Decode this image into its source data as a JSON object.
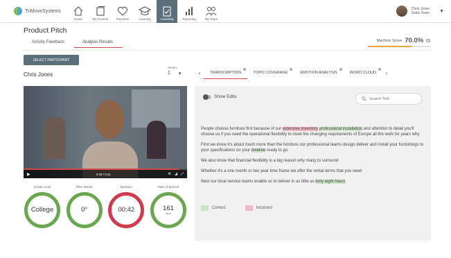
{
  "brand": {
    "name": "TriMoveSystems"
  },
  "nav": [
    {
      "label": "Home",
      "icon": "home-icon",
      "active": false
    },
    {
      "label": "My Content",
      "icon": "content-icon",
      "active": false
    },
    {
      "label": "Favorites",
      "icon": "heart-icon",
      "active": false
    },
    {
      "label": "Learning",
      "icon": "graduation-cap-icon",
      "active": false
    },
    {
      "label": "Coaching",
      "icon": "clipboard-icon",
      "active": true
    },
    {
      "label": "Reporting",
      "icon": "bar-chart-icon",
      "active": false
    },
    {
      "label": "My Team",
      "icon": "team-icon",
      "active": false
    }
  ],
  "user": {
    "name": "Chris Jones",
    "subtitle": "Sales Team"
  },
  "page": {
    "title": "Product Pitch"
  },
  "tabs": [
    {
      "label": "Activity Feedback",
      "active": false
    },
    {
      "label": "Analysis Results",
      "active": true
    }
  ],
  "machine_score": {
    "label": "Machine Score",
    "value": "70.0%",
    "percent": 70
  },
  "select_participant": "SELECT PARTICIPANT",
  "participant": "Chris Jones",
  "written": {
    "label": "Written",
    "value": "1"
  },
  "analysis_tabs": [
    {
      "label": "TRANSCRIPTION",
      "active": true
    },
    {
      "label": "TOPIC COVERAGE",
      "active": false
    },
    {
      "label": "EMOTION ANALYSIS",
      "active": false
    },
    {
      "label": "WORD CLOUD",
      "active": false
    }
  ],
  "video": {
    "time": "0:39 / 0:41",
    "progress": 0.95
  },
  "stats": [
    {
      "label": "Grade Level",
      "value": "College",
      "unit": "",
      "color": "#6aa84f"
    },
    {
      "label": "Filler Words",
      "value": "0°",
      "unit": "",
      "color": "#6aa84f"
    },
    {
      "label": "Duration",
      "value": "00:42",
      "unit": "",
      "color": "#d33a4e"
    },
    {
      "label": "Rate of Speech",
      "value": "161",
      "unit": "wpm",
      "color": "#6aa84f"
    }
  ],
  "panel": {
    "show_edits": "Show Edits",
    "search_placeholder": "Search Text",
    "paragraphs": [
      [
        {
          "t": "People choose furniture first because of our ",
          "h": ""
        },
        {
          "t": "extensive inventory",
          "h": "bad"
        },
        {
          "t": " ",
          "h": ""
        },
        {
          "t": "professional installation",
          "h": "good"
        },
        {
          "t": " and attention to detail you'll choose us if you need the operational flexibility to meet the changing requirements of Europe all the work for years why",
          "h": ""
        }
      ],
      [
        {
          "t": "First we know it's about much more than the furniture our professional teams design deliver and install your furnishings to your specifications on your ",
          "h": ""
        },
        {
          "t": "timeline",
          "h": "good"
        },
        {
          "t": " ready to go",
          "h": ""
        }
      ],
      [
        {
          "t": "We also know that financial flexibility is a big reason why many to surround",
          "h": ""
        }
      ],
      [
        {
          "t": "Whether it's a one month or two year time frame we offer the rental terms that you need",
          "h": ""
        }
      ],
      [
        {
          "t": "Next our local service teams enable us to deliver in as little as ",
          "h": ""
        },
        {
          "t": "forty eight hours",
          "h": "good"
        }
      ]
    ],
    "legend": [
      {
        "label": "Correct",
        "color": "#c9e5c2"
      },
      {
        "label": "Incorrect",
        "color": "#f2b8c6"
      }
    ]
  }
}
